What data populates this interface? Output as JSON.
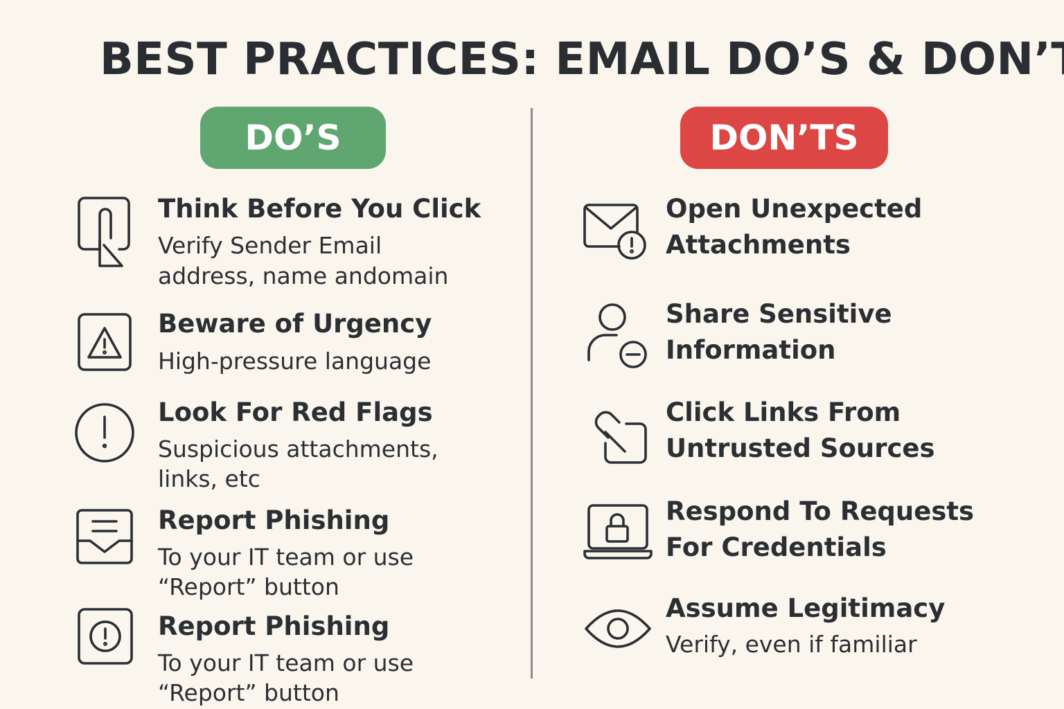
{
  "title": "BEST PRACTICES: EMAIL DO’S & DON’TS",
  "colors": {
    "do_pill": "#5fa671",
    "dont_pill": "#dc4644",
    "background": "#faf6ee",
    "text": "#2b2f33"
  },
  "dos": {
    "heading": "DO’S",
    "items": [
      {
        "icon": "hand-tap-icon",
        "title": "Think Before You Click",
        "desc": [
          "Verify Sender Email",
          "address, name andomain"
        ]
      },
      {
        "icon": "warning-triangle-icon",
        "title": "Beware of Urgency",
        "desc": [
          "High-pressure language"
        ]
      },
      {
        "icon": "exclamation-circle-icon",
        "title": "Look For Red Flags",
        "desc": [
          "Suspicious attachments,",
          "links, etc"
        ]
      },
      {
        "icon": "report-tray-icon",
        "title": "Report Phishing",
        "desc": [
          "To your IT team or use",
          "“Report” button"
        ]
      },
      {
        "icon": "alert-square-icon",
        "title": "Report Phishing",
        "desc": [
          "To your IT team or use",
          "“Report” button"
        ]
      }
    ]
  },
  "donts": {
    "heading": "DON’TS",
    "items": [
      {
        "icon": "envelope-alert-icon",
        "title": [
          "Open Unexpected",
          "Attachments"
        ]
      },
      {
        "icon": "user-minus-icon",
        "title": [
          "Share Sensitive",
          "Information"
        ]
      },
      {
        "icon": "link-icon",
        "title": [
          "Click Links From",
          "Untrusted Sources"
        ]
      },
      {
        "icon": "laptop-lock-icon",
        "title": [
          "Respond To Requests",
          "For Credentials"
        ]
      },
      {
        "icon": "eye-icon",
        "title": [
          "Assume Legitimacy"
        ],
        "desc": "Verify, even if familiar"
      }
    ]
  }
}
